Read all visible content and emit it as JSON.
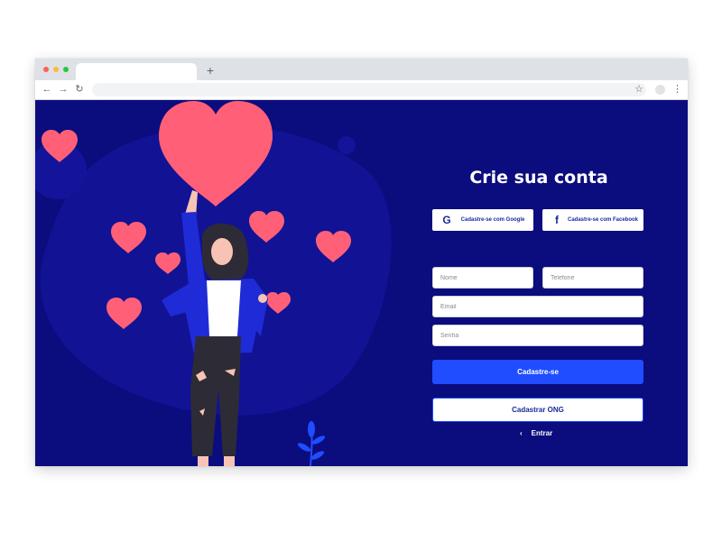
{
  "browser": {
    "new_tab_symbol": "+",
    "back_icon": "←",
    "forward_icon": "→",
    "reload_icon": "↻",
    "bookmark_icon": "☆",
    "menu_icon": "⋮"
  },
  "signup": {
    "title": "Crie sua conta",
    "google_label": "Cadastre-se com Google",
    "google_icon": "G",
    "facebook_label": "Cadastre-se com Facebook",
    "facebook_icon": "f",
    "name_placeholder": "Nome",
    "phone_placeholder": "Telefone",
    "email_placeholder": "Email",
    "password_placeholder": "Senha",
    "submit_label": "Cadastre-se",
    "ngo_label": "Cadastrar ONG",
    "login_arrow": "‹",
    "login_label": "Entrar"
  },
  "colors": {
    "background": "#0b0c7e",
    "accent": "#1f4dff",
    "heart": "#ff6077"
  }
}
